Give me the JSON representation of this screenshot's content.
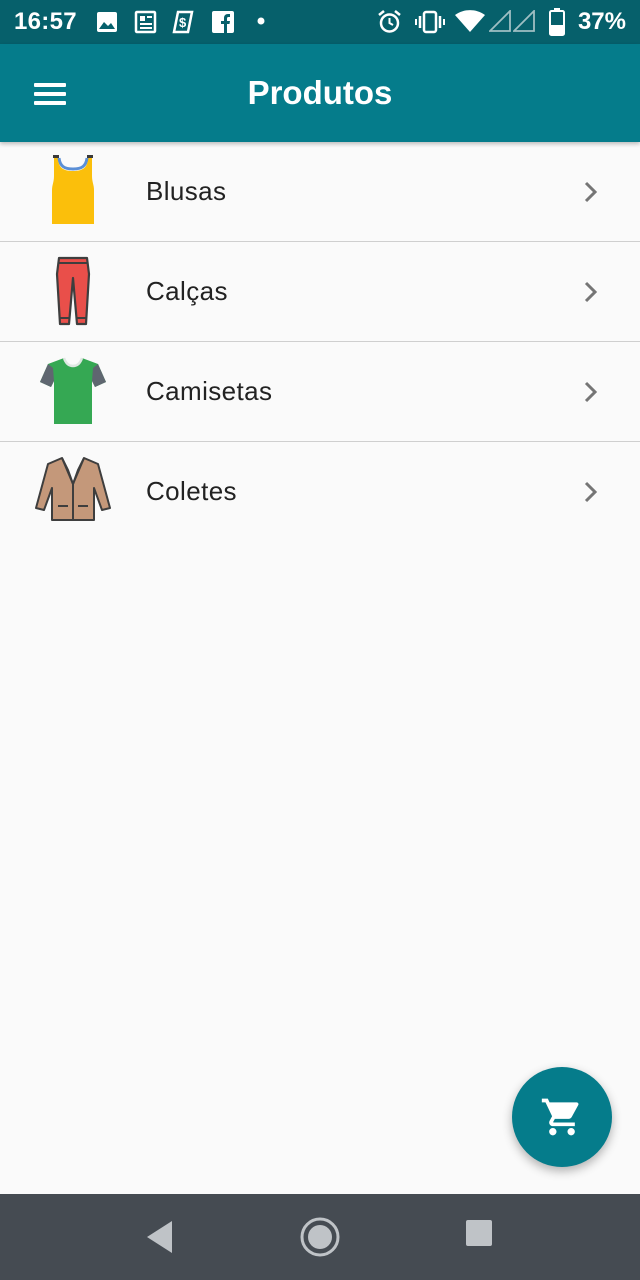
{
  "status_bar": {
    "time": "16:57",
    "battery": "37%",
    "icons": [
      "image-icon",
      "news-icon",
      "payment-icon",
      "facebook-icon",
      "dot-icon",
      "alarm-icon",
      "vibrate-icon",
      "wifi-icon",
      "signal-icon",
      "signal-icon",
      "battery-icon"
    ]
  },
  "app_bar": {
    "title": "Produtos",
    "menu_icon": "hamburger-menu-icon"
  },
  "categories": [
    {
      "label": "Blusas",
      "icon": "tank-top-icon"
    },
    {
      "label": "Calças",
      "icon": "pants-icon"
    },
    {
      "label": "Camisetas",
      "icon": "tshirt-icon"
    },
    {
      "label": "Coletes",
      "icon": "jacket-icon"
    }
  ],
  "fab": {
    "icon": "shopping-cart-icon"
  },
  "colors": {
    "primary": "#057c8b",
    "status_bar": "#06606b",
    "nav_bar": "#454b52",
    "background": "#fafafa"
  }
}
